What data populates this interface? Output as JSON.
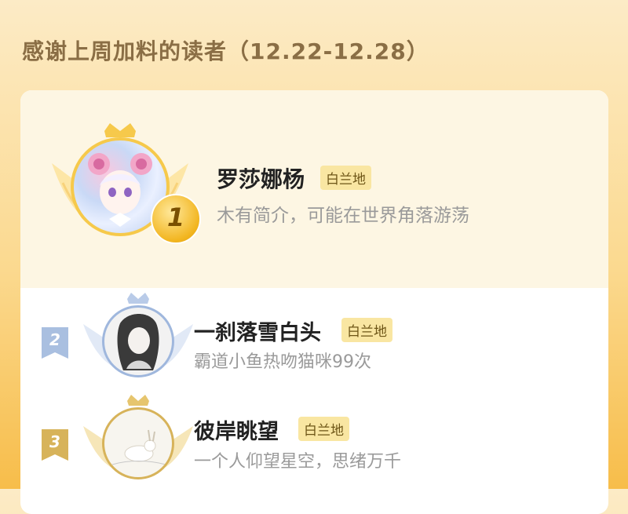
{
  "header": {
    "title": "感谢上周加料的读者（12.22-12.28）"
  },
  "readers": [
    {
      "rank": "1",
      "name": "罗莎娜杨",
      "badge": "白兰地",
      "bio": "木有简介，可能在世界角落游荡"
    },
    {
      "rank": "2",
      "name": "一刹落雪白头",
      "badge": "白兰地",
      "bio": "霸道小鱼热吻猫咪99次"
    },
    {
      "rank": "3",
      "name": "彼岸眺望",
      "badge": "白兰地",
      "bio": "一个人仰望星空，思绪万千"
    }
  ],
  "colors": {
    "gold": "#f2b51f",
    "silver": "#a9bfe0",
    "bronze": "#d7b35a",
    "badge_bg": "#f9e6a2"
  }
}
